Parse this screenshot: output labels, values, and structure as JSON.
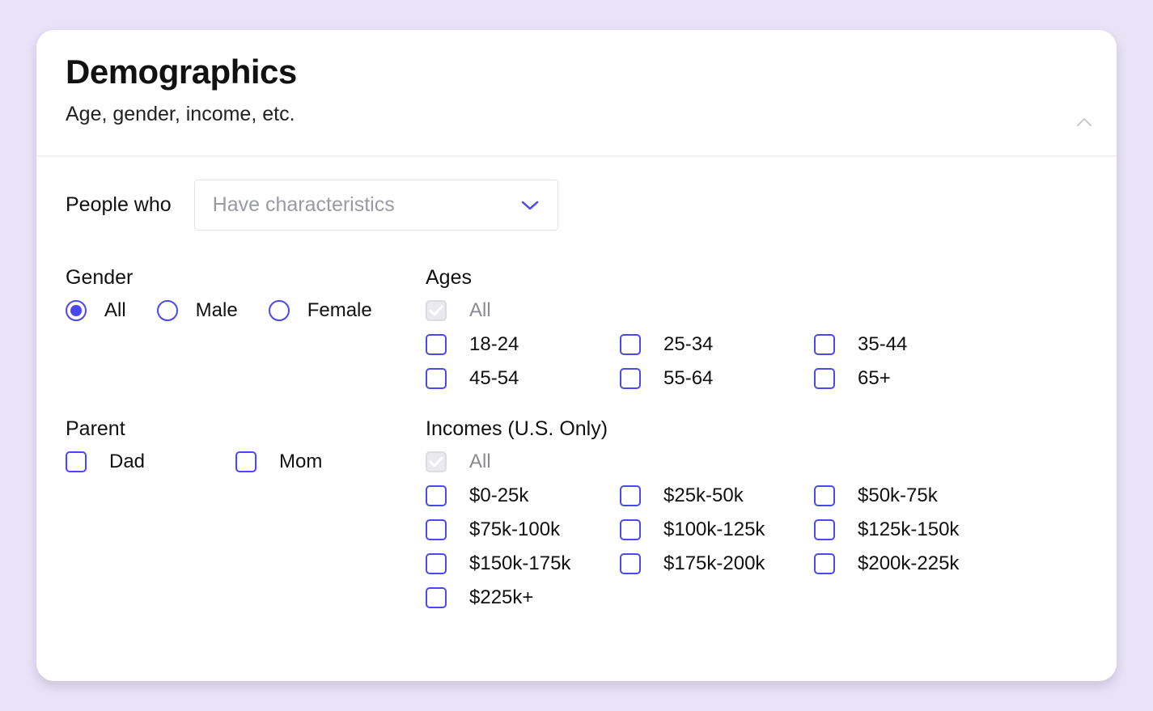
{
  "header": {
    "title": "Demographics",
    "subtitle": "Age, gender, income, etc."
  },
  "filter": {
    "label": "People who",
    "placeholder": "Have characteristics"
  },
  "gender": {
    "label": "Gender",
    "options": [
      "All",
      "Male",
      "Female"
    ],
    "selected": "All"
  },
  "ages": {
    "label": "Ages",
    "all_label": "All",
    "options": [
      "18-24",
      "25-34",
      "35-44",
      "45-54",
      "55-64",
      "65+"
    ]
  },
  "parent": {
    "label": "Parent",
    "options": [
      "Dad",
      "Mom"
    ]
  },
  "incomes": {
    "label": "Incomes (U.S. Only)",
    "all_label": "All",
    "options": [
      "$0-25k",
      "$25k-50k",
      "$50k-75k",
      "$75k-100k",
      "$100k-125k",
      "$125k-150k",
      "$150k-175k",
      "$175k-200k",
      "$200k-225k",
      "$225k+"
    ]
  }
}
